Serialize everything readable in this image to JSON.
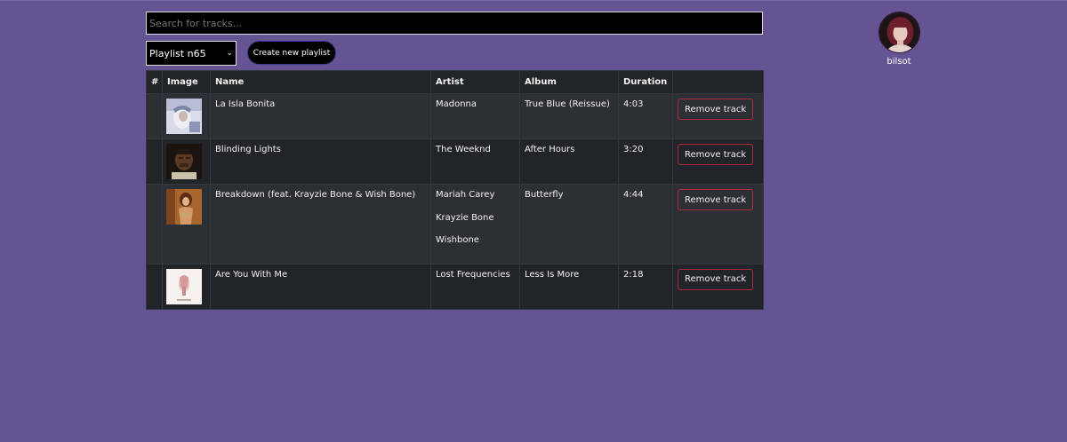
{
  "search": {
    "placeholder": "Search for tracks..."
  },
  "playlist_select": {
    "selected": "Playlist n65"
  },
  "create_button": {
    "label": "Create new playlist"
  },
  "user": {
    "name": "bilsot"
  },
  "table": {
    "headers": [
      "#",
      "Image",
      "Name",
      "Artist",
      "Album",
      "Duration",
      ""
    ],
    "rows": [
      {
        "number": "",
        "name": "La Isla Bonita",
        "artists": [
          "Madonna"
        ],
        "album": "True Blue (Reissue)",
        "duration": "4:03",
        "action": "Remove track"
      },
      {
        "number": "",
        "name": "Blinding Lights",
        "artists": [
          "The Weeknd"
        ],
        "album": "After Hours",
        "duration": "3:20",
        "action": "Remove track"
      },
      {
        "number": "",
        "name": "Breakdown (feat. Krayzie Bone & Wish Bone)",
        "artists": [
          "Mariah Carey",
          "Krayzie Bone",
          "Wishbone"
        ],
        "album": "Butterfly",
        "duration": "4:44",
        "action": "Remove track"
      },
      {
        "number": "",
        "name": "Are You With Me",
        "artists": [
          "Lost Frequencies"
        ],
        "album": "Less Is More",
        "duration": "2:18",
        "action": "Remove track"
      }
    ]
  },
  "colors": {
    "background": "#645494",
    "table_bg": "#212529",
    "table_row_alt": "#2c3034",
    "danger": "#b02a37"
  }
}
